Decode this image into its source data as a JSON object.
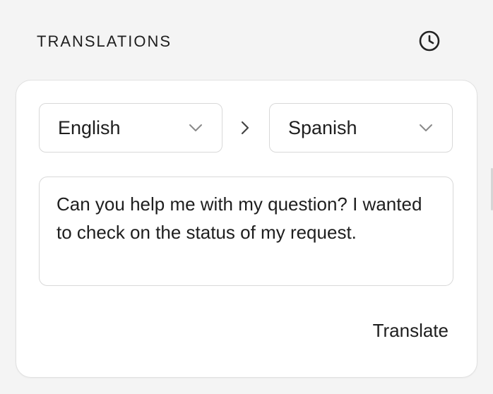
{
  "header": {
    "title": "TRANSLATIONS",
    "history_icon": "clock-icon"
  },
  "translator": {
    "source_language": "English",
    "target_language": "Spanish",
    "arrow_icon": "chevron-right-icon",
    "dropdown_icon": "chevron-down-icon",
    "input_text": "Can you help me with my question? I wanted to check on the status of my request.",
    "translate_label": "Translate"
  },
  "colors": {
    "background": "#f4f4f4",
    "card": "#ffffff",
    "border": "#d9d9d9",
    "text": "#1e1e1e",
    "icon": "#222222"
  }
}
